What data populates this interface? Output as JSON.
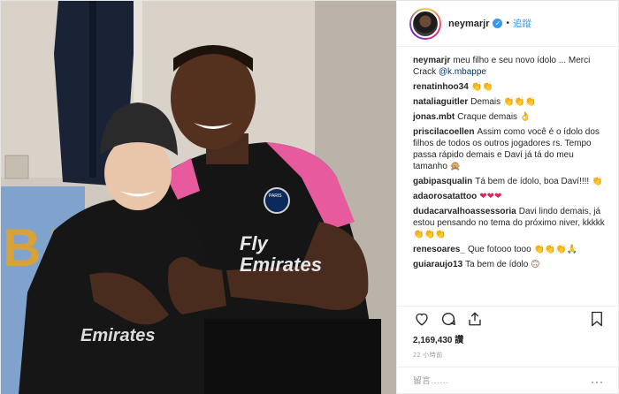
{
  "post": {
    "author": "neymarjr",
    "follow_label": "追蹤",
    "separator": "•",
    "verified_glyph": "✓",
    "caption_username": "neymarjr",
    "caption_text": "meu filho e seu novo ídolo ... Merci Crack ",
    "caption_mention": "@k.mbappe",
    "likes": "2,169,430 讚",
    "time": "22 小時前",
    "comment_placeholder": "留言……",
    "more_label": "···",
    "photo_text": {
      "chest_line1": "Fly",
      "chest_line2": "Emirates",
      "crest": "PARIS",
      "child_shirt": "Emirates",
      "banner": "BJ"
    }
  },
  "comments": [
    {
      "user": "renatinhoo34",
      "text": "",
      "emojis": [
        "👏",
        "👏"
      ]
    },
    {
      "user": "nataliaguitler",
      "text": "Demais ",
      "emojis": [
        "👏",
        "👏",
        "👏"
      ]
    },
    {
      "user": "jonas.mbt",
      "text": "Craque demais ",
      "emojis": [
        "👌"
      ]
    },
    {
      "user": "priscilacoellen",
      "text": "Assim como você é o ídolo dos filhos de todos os outros jogadores rs. Tempo passa rápido demais e Daví já tá do meu tamanho ",
      "emojis": [
        "🙊"
      ]
    },
    {
      "user": "gabipasqualin",
      "text": "Tá bem de ídolo, boa Daví!!!! ",
      "emojis": [
        "👏"
      ]
    },
    {
      "user": "adaorosatattoo",
      "text": "",
      "emojis": [
        "❤",
        "❤",
        "❤"
      ]
    },
    {
      "user": "dudacarvalhoassessoria",
      "text": "Davi lindo demais, já estou pensando no tema do próximo niver, kkkkk",
      "emojis": [
        "👏",
        "👏",
        "👏"
      ]
    },
    {
      "user": "renesoares_",
      "text": "Que fotooo tooo ",
      "emojis": [
        "👏",
        "👏",
        "👏",
        "🙏"
      ]
    },
    {
      "user": "guiaraujo13",
      "text": "Ta bem de ídolo ",
      "emojis": [
        "🙃"
      ]
    }
  ],
  "icons": {
    "like": "heart-outline-icon",
    "comment": "speech-bubble-icon",
    "share": "share-upload-icon",
    "save": "bookmark-icon",
    "verified": "verified-badge-icon"
  },
  "colors": {
    "link_blue": "#3897f0",
    "mention_blue": "#003569",
    "border": "#efefef",
    "muted": "#999999",
    "heart_red": "#e0245e",
    "psg_pink": "#e85a9e"
  }
}
